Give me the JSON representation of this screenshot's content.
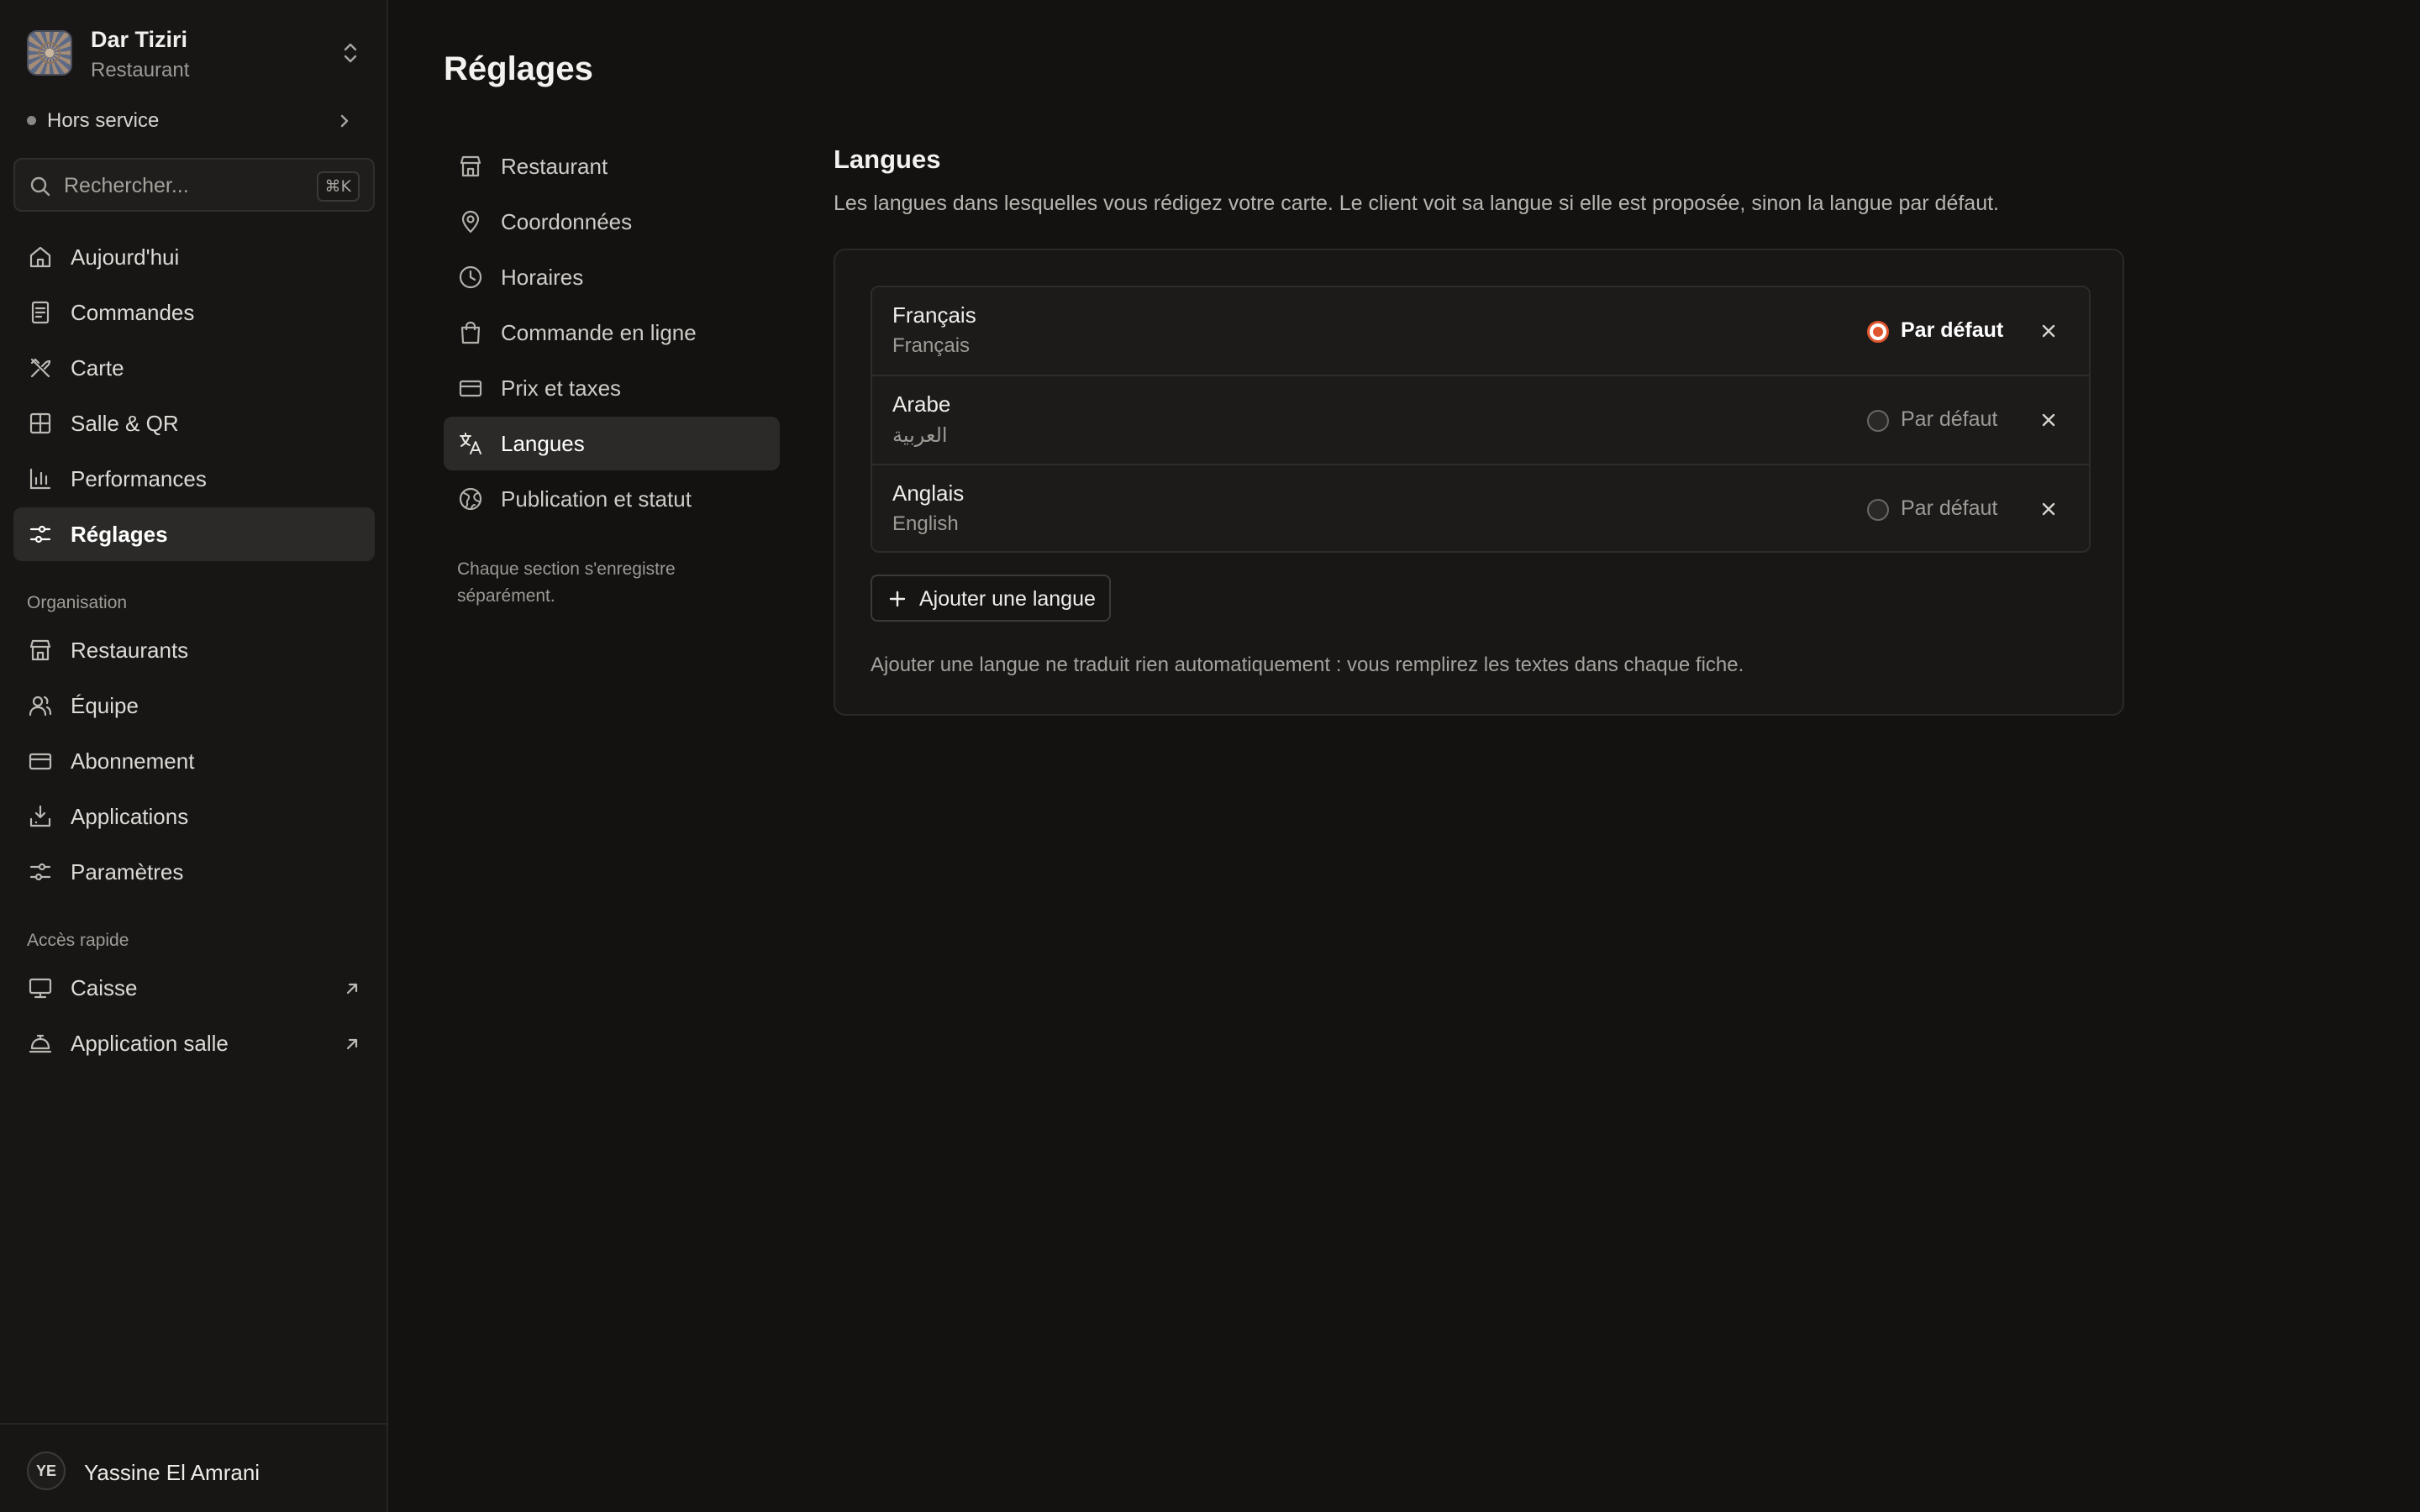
{
  "brand": {
    "name": "Dar Tiziri",
    "subtitle": "Restaurant"
  },
  "status": {
    "label": "Hors service"
  },
  "search": {
    "placeholder": "Rechercher...",
    "shortcut": "⌘K"
  },
  "sidebar": {
    "main": [
      {
        "label": "Aujourd'hui",
        "icon": "home-icon"
      },
      {
        "label": "Commandes",
        "icon": "receipt-icon"
      },
      {
        "label": "Carte",
        "icon": "utensils-icon"
      },
      {
        "label": "Salle & QR",
        "icon": "grid-icon"
      },
      {
        "label": "Performances",
        "icon": "bar-chart-icon"
      },
      {
        "label": "Réglages",
        "icon": "sliders-icon",
        "active": true
      }
    ],
    "org_title": "Organisation",
    "org": [
      {
        "label": "Restaurants",
        "icon": "store-icon"
      },
      {
        "label": "Équipe",
        "icon": "users-icon"
      },
      {
        "label": "Abonnement",
        "icon": "credit-card-icon"
      },
      {
        "label": "Applications",
        "icon": "download-icon"
      },
      {
        "label": "Paramètres",
        "icon": "settings-sliders-icon"
      }
    ],
    "quick_title": "Accès rapide",
    "quick": [
      {
        "label": "Caisse",
        "icon": "monitor-icon"
      },
      {
        "label": "Application salle",
        "icon": "bell-service-icon"
      }
    ]
  },
  "user": {
    "initials": "YE",
    "name": "Yassine El Amrani"
  },
  "page": {
    "title": "Réglages"
  },
  "subnav": {
    "items": [
      {
        "label": "Restaurant",
        "icon": "store-icon"
      },
      {
        "label": "Coordonnées",
        "icon": "map-pin-icon"
      },
      {
        "label": "Horaires",
        "icon": "clock-icon"
      },
      {
        "label": "Commande en ligne",
        "icon": "shopping-bag-icon"
      },
      {
        "label": "Prix et taxes",
        "icon": "credit-card-icon"
      },
      {
        "label": "Langues",
        "icon": "translate-icon",
        "active": true
      },
      {
        "label": "Publication et statut",
        "icon": "globe-icon"
      }
    ],
    "note": "Chaque section s'enregistre séparément."
  },
  "languages": {
    "title": "Langues",
    "description": "Les langues dans lesquelles vous rédigez votre carte. Le client voit sa langue si elle est proposée, sinon la langue par défaut.",
    "default_label": "Par défaut",
    "items": [
      {
        "name": "Français",
        "native": "Français",
        "is_default": true
      },
      {
        "name": "Arabe",
        "native": "العربية",
        "is_default": false
      },
      {
        "name": "Anglais",
        "native": "English",
        "is_default": false
      }
    ],
    "add_label": "Ajouter une langue",
    "note": "Ajouter une langue ne traduit rien automatiquement : vous remplirez les textes dans chaque fiche."
  },
  "colors": {
    "accent": "#e0572f",
    "background": "#131211",
    "sidebar": "#171615"
  }
}
